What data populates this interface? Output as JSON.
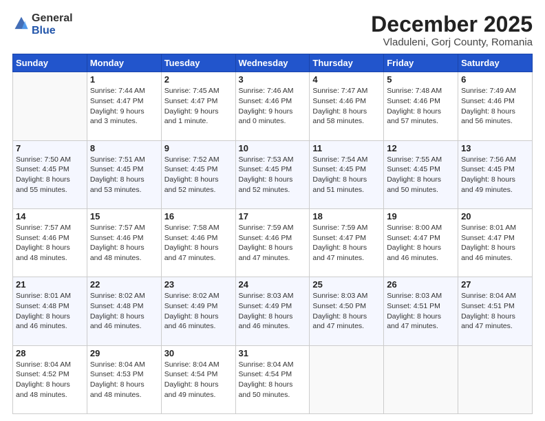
{
  "header": {
    "logo": {
      "line1": "General",
      "line2": "Blue"
    },
    "title": "December 2025",
    "location": "Vladuleni, Gorj County, Romania"
  },
  "weekdays": [
    "Sunday",
    "Monday",
    "Tuesday",
    "Wednesday",
    "Thursday",
    "Friday",
    "Saturday"
  ],
  "weeks": [
    [
      {
        "day": "",
        "info": ""
      },
      {
        "day": "1",
        "info": "Sunrise: 7:44 AM\nSunset: 4:47 PM\nDaylight: 9 hours\nand 3 minutes."
      },
      {
        "day": "2",
        "info": "Sunrise: 7:45 AM\nSunset: 4:47 PM\nDaylight: 9 hours\nand 1 minute."
      },
      {
        "day": "3",
        "info": "Sunrise: 7:46 AM\nSunset: 4:46 PM\nDaylight: 9 hours\nand 0 minutes."
      },
      {
        "day": "4",
        "info": "Sunrise: 7:47 AM\nSunset: 4:46 PM\nDaylight: 8 hours\nand 58 minutes."
      },
      {
        "day": "5",
        "info": "Sunrise: 7:48 AM\nSunset: 4:46 PM\nDaylight: 8 hours\nand 57 minutes."
      },
      {
        "day": "6",
        "info": "Sunrise: 7:49 AM\nSunset: 4:46 PM\nDaylight: 8 hours\nand 56 minutes."
      }
    ],
    [
      {
        "day": "7",
        "info": "Sunrise: 7:50 AM\nSunset: 4:45 PM\nDaylight: 8 hours\nand 55 minutes."
      },
      {
        "day": "8",
        "info": "Sunrise: 7:51 AM\nSunset: 4:45 PM\nDaylight: 8 hours\nand 53 minutes."
      },
      {
        "day": "9",
        "info": "Sunrise: 7:52 AM\nSunset: 4:45 PM\nDaylight: 8 hours\nand 52 minutes."
      },
      {
        "day": "10",
        "info": "Sunrise: 7:53 AM\nSunset: 4:45 PM\nDaylight: 8 hours\nand 52 minutes."
      },
      {
        "day": "11",
        "info": "Sunrise: 7:54 AM\nSunset: 4:45 PM\nDaylight: 8 hours\nand 51 minutes."
      },
      {
        "day": "12",
        "info": "Sunrise: 7:55 AM\nSunset: 4:45 PM\nDaylight: 8 hours\nand 50 minutes."
      },
      {
        "day": "13",
        "info": "Sunrise: 7:56 AM\nSunset: 4:45 PM\nDaylight: 8 hours\nand 49 minutes."
      }
    ],
    [
      {
        "day": "14",
        "info": "Sunrise: 7:57 AM\nSunset: 4:46 PM\nDaylight: 8 hours\nand 48 minutes."
      },
      {
        "day": "15",
        "info": "Sunrise: 7:57 AM\nSunset: 4:46 PM\nDaylight: 8 hours\nand 48 minutes."
      },
      {
        "day": "16",
        "info": "Sunrise: 7:58 AM\nSunset: 4:46 PM\nDaylight: 8 hours\nand 47 minutes."
      },
      {
        "day": "17",
        "info": "Sunrise: 7:59 AM\nSunset: 4:46 PM\nDaylight: 8 hours\nand 47 minutes."
      },
      {
        "day": "18",
        "info": "Sunrise: 7:59 AM\nSunset: 4:47 PM\nDaylight: 8 hours\nand 47 minutes."
      },
      {
        "day": "19",
        "info": "Sunrise: 8:00 AM\nSunset: 4:47 PM\nDaylight: 8 hours\nand 46 minutes."
      },
      {
        "day": "20",
        "info": "Sunrise: 8:01 AM\nSunset: 4:47 PM\nDaylight: 8 hours\nand 46 minutes."
      }
    ],
    [
      {
        "day": "21",
        "info": "Sunrise: 8:01 AM\nSunset: 4:48 PM\nDaylight: 8 hours\nand 46 minutes."
      },
      {
        "day": "22",
        "info": "Sunrise: 8:02 AM\nSunset: 4:48 PM\nDaylight: 8 hours\nand 46 minutes."
      },
      {
        "day": "23",
        "info": "Sunrise: 8:02 AM\nSunset: 4:49 PM\nDaylight: 8 hours\nand 46 minutes."
      },
      {
        "day": "24",
        "info": "Sunrise: 8:03 AM\nSunset: 4:49 PM\nDaylight: 8 hours\nand 46 minutes."
      },
      {
        "day": "25",
        "info": "Sunrise: 8:03 AM\nSunset: 4:50 PM\nDaylight: 8 hours\nand 47 minutes."
      },
      {
        "day": "26",
        "info": "Sunrise: 8:03 AM\nSunset: 4:51 PM\nDaylight: 8 hours\nand 47 minutes."
      },
      {
        "day": "27",
        "info": "Sunrise: 8:04 AM\nSunset: 4:51 PM\nDaylight: 8 hours\nand 47 minutes."
      }
    ],
    [
      {
        "day": "28",
        "info": "Sunrise: 8:04 AM\nSunset: 4:52 PM\nDaylight: 8 hours\nand 48 minutes."
      },
      {
        "day": "29",
        "info": "Sunrise: 8:04 AM\nSunset: 4:53 PM\nDaylight: 8 hours\nand 48 minutes."
      },
      {
        "day": "30",
        "info": "Sunrise: 8:04 AM\nSunset: 4:54 PM\nDaylight: 8 hours\nand 49 minutes."
      },
      {
        "day": "31",
        "info": "Sunrise: 8:04 AM\nSunset: 4:54 PM\nDaylight: 8 hours\nand 50 minutes."
      },
      {
        "day": "",
        "info": ""
      },
      {
        "day": "",
        "info": ""
      },
      {
        "day": "",
        "info": ""
      }
    ]
  ]
}
